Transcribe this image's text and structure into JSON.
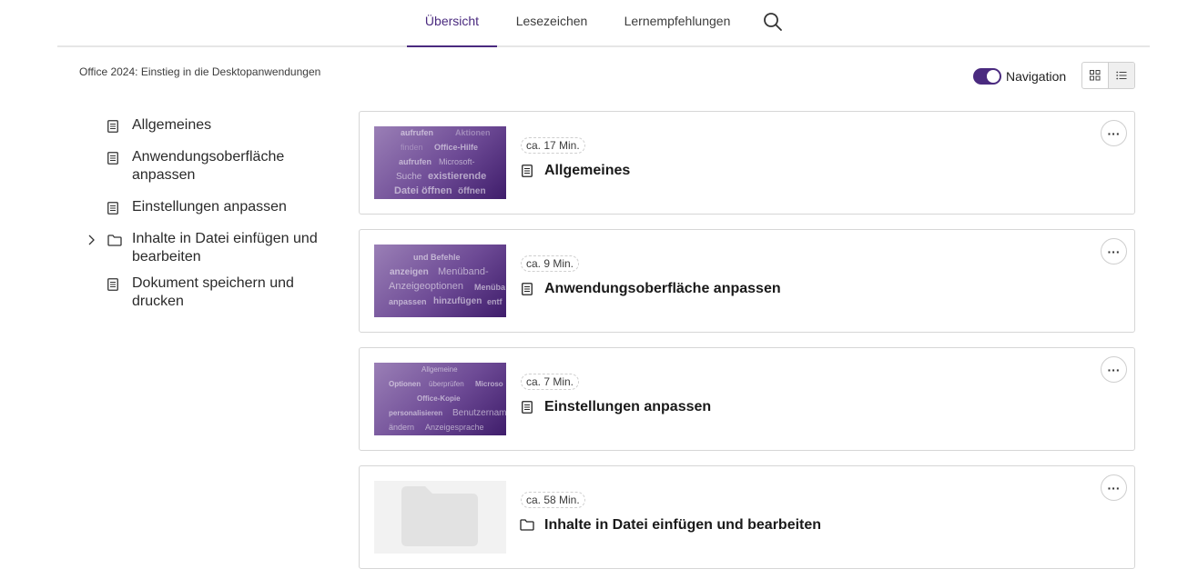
{
  "tabs": [
    {
      "label": "Übersicht",
      "active": true
    },
    {
      "label": "Lesezeichen",
      "active": false
    },
    {
      "label": "Lernempfehlungen",
      "active": false
    }
  ],
  "search_icon": "search-icon",
  "course_title": "Office 2024: Einstieg in die Desktopanwendungen",
  "navigation_toggle": {
    "label": "Navigation",
    "on": true
  },
  "view_switch": {
    "grid_icon": "grid-icon",
    "list_icon": "list-icon",
    "selected": "list"
  },
  "sidebar": {
    "items": [
      {
        "label": "Allgemeines",
        "icon": "document-icon",
        "expandable": false
      },
      {
        "label": "Anwendungsoberfläche anpassen",
        "icon": "document-icon",
        "expandable": false
      },
      {
        "label": "Einstellungen anpassen",
        "icon": "document-icon",
        "expandable": false
      },
      {
        "label": "Inhalte in Datei einfügen und bearbeiten",
        "icon": "folder-icon",
        "expandable": true
      },
      {
        "label": "Dokument speichern und drucken",
        "icon": "document-icon",
        "expandable": false
      }
    ]
  },
  "cards": [
    {
      "duration": "ca. 17 Min.",
      "title": "Allgemeines",
      "icon": "document-icon",
      "thumb_words": [
        "aufrufen",
        "Aktionen",
        "finden",
        "Office-Hilfe",
        "aufrufen",
        "Microsoft-",
        "Suche",
        "existierende",
        "Datei öffnen",
        "öffnen"
      ]
    },
    {
      "duration": "ca. 9 Min.",
      "title": "Anwendungsoberfläche anpassen",
      "icon": "document-icon",
      "thumb_words": [
        "und Befehle",
        "anzeigen",
        "Menüband-",
        "Anzeigeoptionen",
        "Menüba",
        "anpassen",
        "hinzufügen",
        "entf"
      ]
    },
    {
      "duration": "ca. 7 Min.",
      "title": "Einstellungen anpassen",
      "icon": "document-icon",
      "thumb_words": [
        "Allgemeine",
        "Optionen",
        "überprüfen",
        "Microso",
        "Office-Kopie",
        "personalisieren",
        "Benutzernam",
        "ändern",
        "Anzeigesprache"
      ]
    },
    {
      "duration": "ca. 58 Min.",
      "title": "Inhalte in Datei einfügen und bearbeiten",
      "icon": "folder-icon",
      "thumb_words": []
    }
  ],
  "more_label": "···"
}
